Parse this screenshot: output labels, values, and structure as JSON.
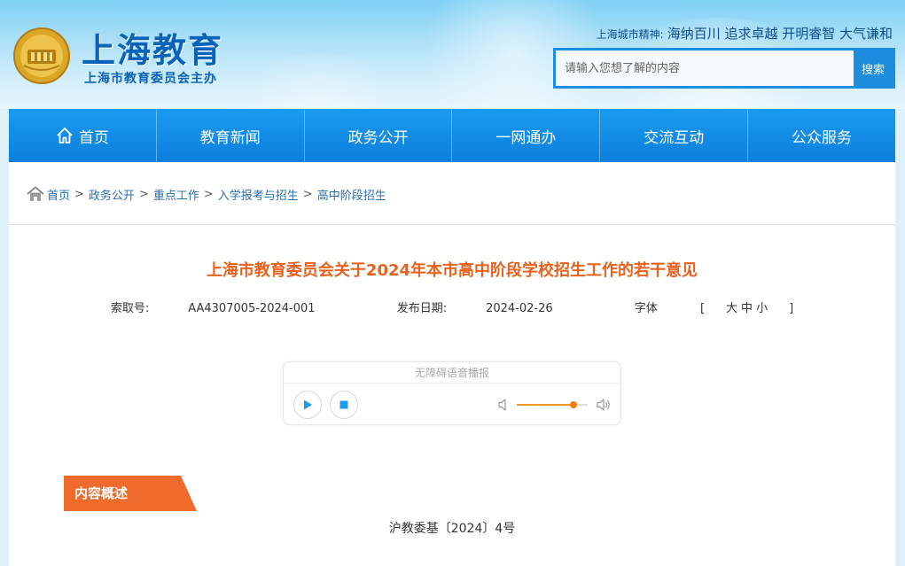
{
  "header": {
    "logo_title": "上海教育",
    "logo_subtitle": "上海市教育委员会主办",
    "spirit_label": "上海城市精神:",
    "spirit_text": "海纳百川 追求卓越 开明睿智 大气谦和",
    "search_placeholder": "请输入您想了解的内容",
    "search_button": "搜索"
  },
  "nav": {
    "items": [
      {
        "label": "首页",
        "icon": "home-icon"
      },
      {
        "label": "教育新闻"
      },
      {
        "label": "政务公开"
      },
      {
        "label": "一网通办"
      },
      {
        "label": "交流互动"
      },
      {
        "label": "公众服务"
      }
    ]
  },
  "breadcrumb": {
    "items": [
      "首页",
      "政务公开",
      "重点工作",
      "入学报考与招生",
      "高中阶段招生"
    ],
    "separator": ">"
  },
  "article": {
    "title": "上海市教育委员会关于2024年本市高中阶段学校招生工作的若干意见",
    "index_label": "索取号:",
    "index_value": "AA4307005-2024-001",
    "date_label": "发布日期:",
    "date_value": "2024-02-26",
    "font_label": "字体",
    "font_sizes": [
      "大",
      "中",
      "小"
    ],
    "bracket_open": "[",
    "bracket_close": "]",
    "section_tag": "内容概述",
    "doc_number": "沪教委基〔2024〕4号"
  },
  "player": {
    "title": "无障碍语音播报",
    "volume_level": 0.8,
    "accent_color": "#f07d10"
  },
  "colors": {
    "nav_bg": "#0c7fdc",
    "title_color": "#e8621f",
    "tag_bg": "#ee6b2c",
    "link_color": "#2a6fb0"
  }
}
